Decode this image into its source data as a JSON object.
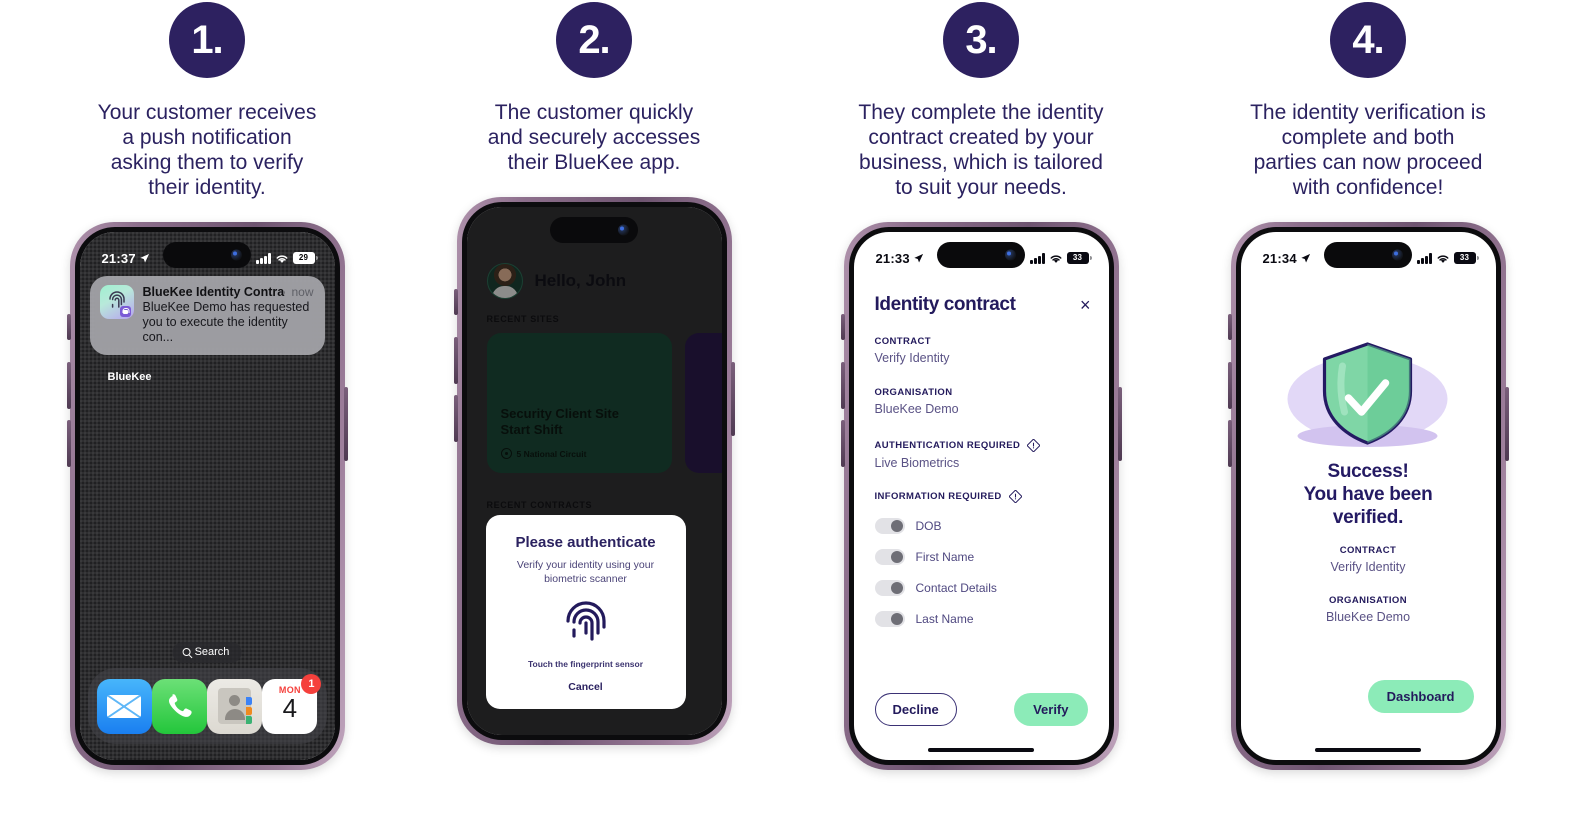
{
  "theme": {
    "brand_navy": "#2d2160",
    "caption_text": "#2b2260",
    "accent_green": "#8cebb8",
    "frame_purple": "#8d6f8c",
    "site_card_green": "#1d4b39",
    "site_card_purple": "#2b1a4d"
  },
  "steps": [
    {
      "number": "1.",
      "caption": "Your customer receives\na push notification\nasking them to verify\ntheir identity."
    },
    {
      "number": "2.",
      "caption": "The customer quickly\nand securely accesses\ntheir BlueKee app."
    },
    {
      "number": "3.",
      "caption": "They complete the identity\ncontract created by your\nbusiness, which is tailored\nto suit your needs."
    },
    {
      "number": "4.",
      "caption": "The identity verification is\ncomplete and both\nparties can now proceed\nwith confidence!"
    }
  ],
  "phone1": {
    "status": {
      "time": "21:37",
      "battery": "29"
    },
    "notification": {
      "title": "BlueKee Identity Contrac...",
      "time": "now",
      "body": "BlueKee Demo has requested you to execute the identity con...",
      "app_name": "BlueKee"
    },
    "search_pill": "Search",
    "dock": [
      {
        "name": "Mail"
      },
      {
        "name": "Phone"
      },
      {
        "name": "Contacts"
      },
      {
        "name": "Calendar",
        "weekday": "MON",
        "day": "4",
        "badge": "1"
      }
    ]
  },
  "phone2": {
    "greeting": "Hello, John",
    "section_sites": "RECENT SITES",
    "section_contracts": "RECENT CONTRACTS",
    "site_card": {
      "title": "Security Client Site\nStart Shift",
      "address": "5 National Circuit"
    },
    "auth_modal": {
      "title": "Please authenticate",
      "subtitle": "Verify your identity using your biometric scanner",
      "hint": "Touch the fingerprint sensor",
      "cancel": "Cancel"
    }
  },
  "phone3": {
    "status": {
      "time": "21:33",
      "battery": "33"
    },
    "title": "Identity contract",
    "close": "×",
    "fields": [
      {
        "key": "CONTRACT",
        "value": "Verify Identity",
        "warn": false
      },
      {
        "key": "ORGANISATION",
        "value": "BlueKee Demo",
        "warn": false
      },
      {
        "key": "AUTHENTICATION REQUIRED",
        "value": "Live Biometrics",
        "warn": true
      }
    ],
    "info_required_label": "INFORMATION REQUIRED",
    "toggles": [
      {
        "label": "DOB",
        "on": false
      },
      {
        "label": "First Name",
        "on": false
      },
      {
        "label": "Contact Details",
        "on": false
      },
      {
        "label": "Last Name",
        "on": false
      }
    ],
    "decline_label": "Decline",
    "verify_label": "Verify"
  },
  "phone4": {
    "status": {
      "time": "21:34",
      "battery": "33"
    },
    "headline": "Success!\nYou have been\nverified.",
    "fields": [
      {
        "key": "CONTRACT",
        "value": "Verify Identity"
      },
      {
        "key": "ORGANISATION",
        "value": "BlueKee Demo"
      }
    ],
    "dashboard_label": "Dashboard"
  }
}
